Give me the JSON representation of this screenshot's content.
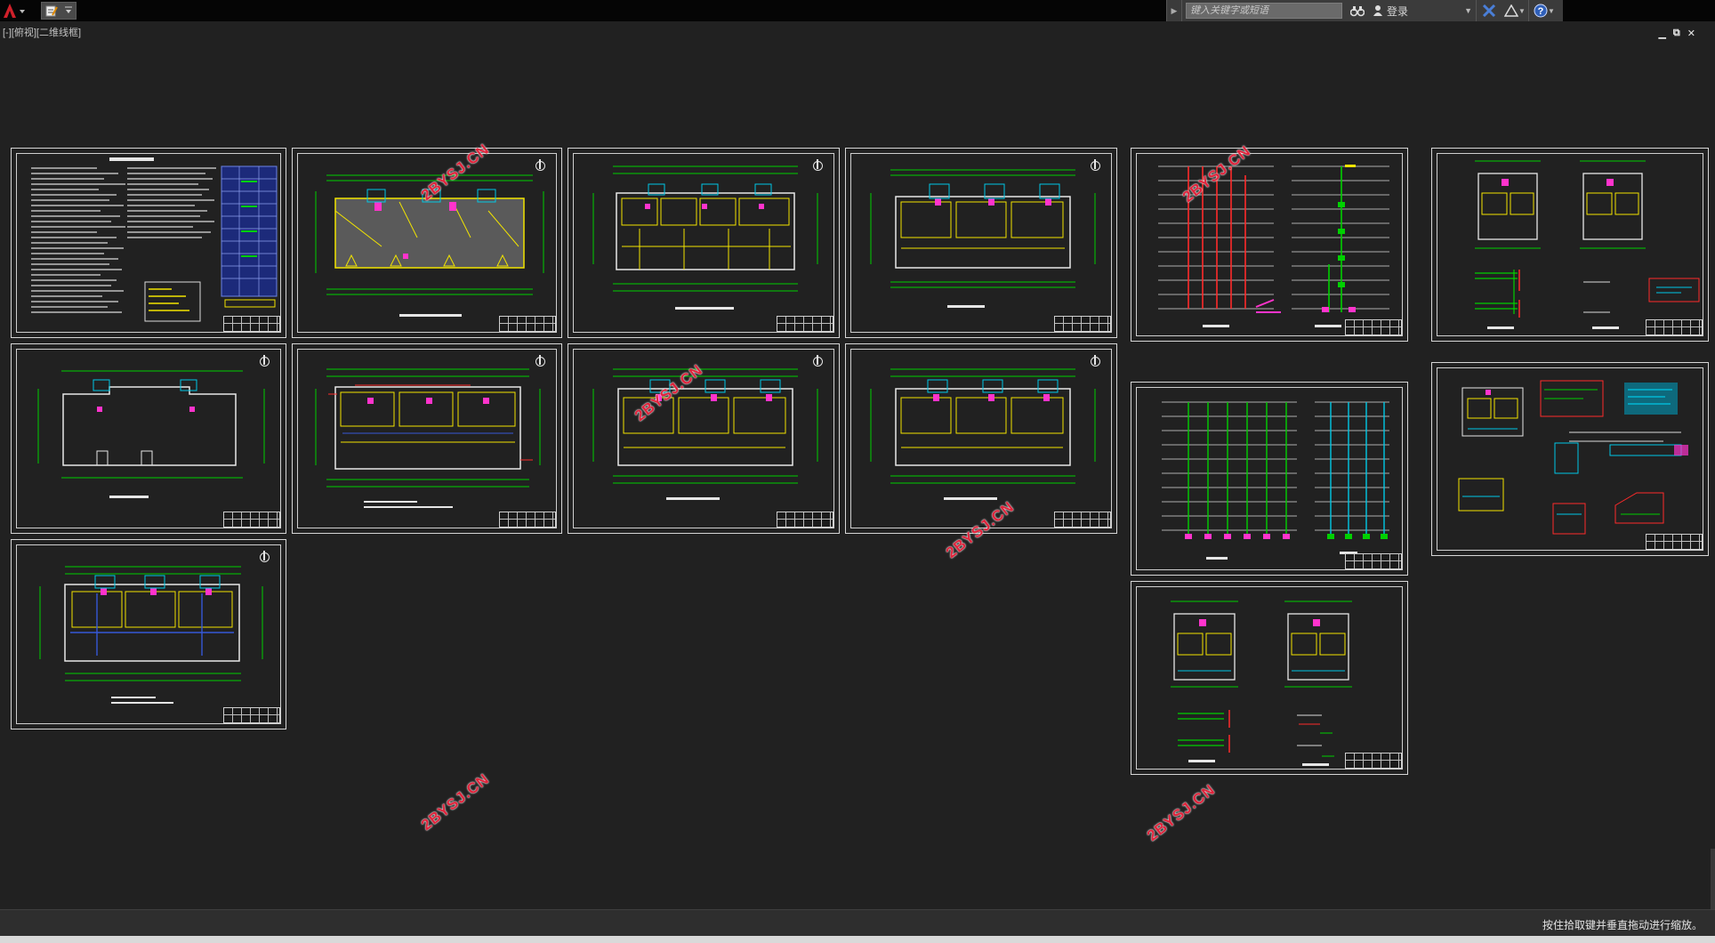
{
  "titlebar": {
    "app_icon": "autocad-a-icon",
    "quick_access_icon": "document-edit-icon",
    "search_placeholder": "键入关键字或短语",
    "login_label": "登录",
    "brand_color": "#d0202a"
  },
  "viewport": {
    "label": "[-][俯视][二维线框]",
    "controls": [
      "▁",
      "⧉",
      "✕"
    ]
  },
  "watermark_text": "2BYSJ.CN",
  "statusbar": {
    "message": "按住拾取键并垂直拖动进行缩放。"
  },
  "colors": {
    "background": "#212121",
    "sheet_border": "#d6d6d6",
    "plan_green": "#00d000",
    "plan_yellow": "#f2e400",
    "plan_cyan": "#00c8e6",
    "plan_magenta": "#ff33cc",
    "plan_red": "#ff2a2a",
    "plan_blue": "#3658d8",
    "watermark": "#e0243c"
  }
}
